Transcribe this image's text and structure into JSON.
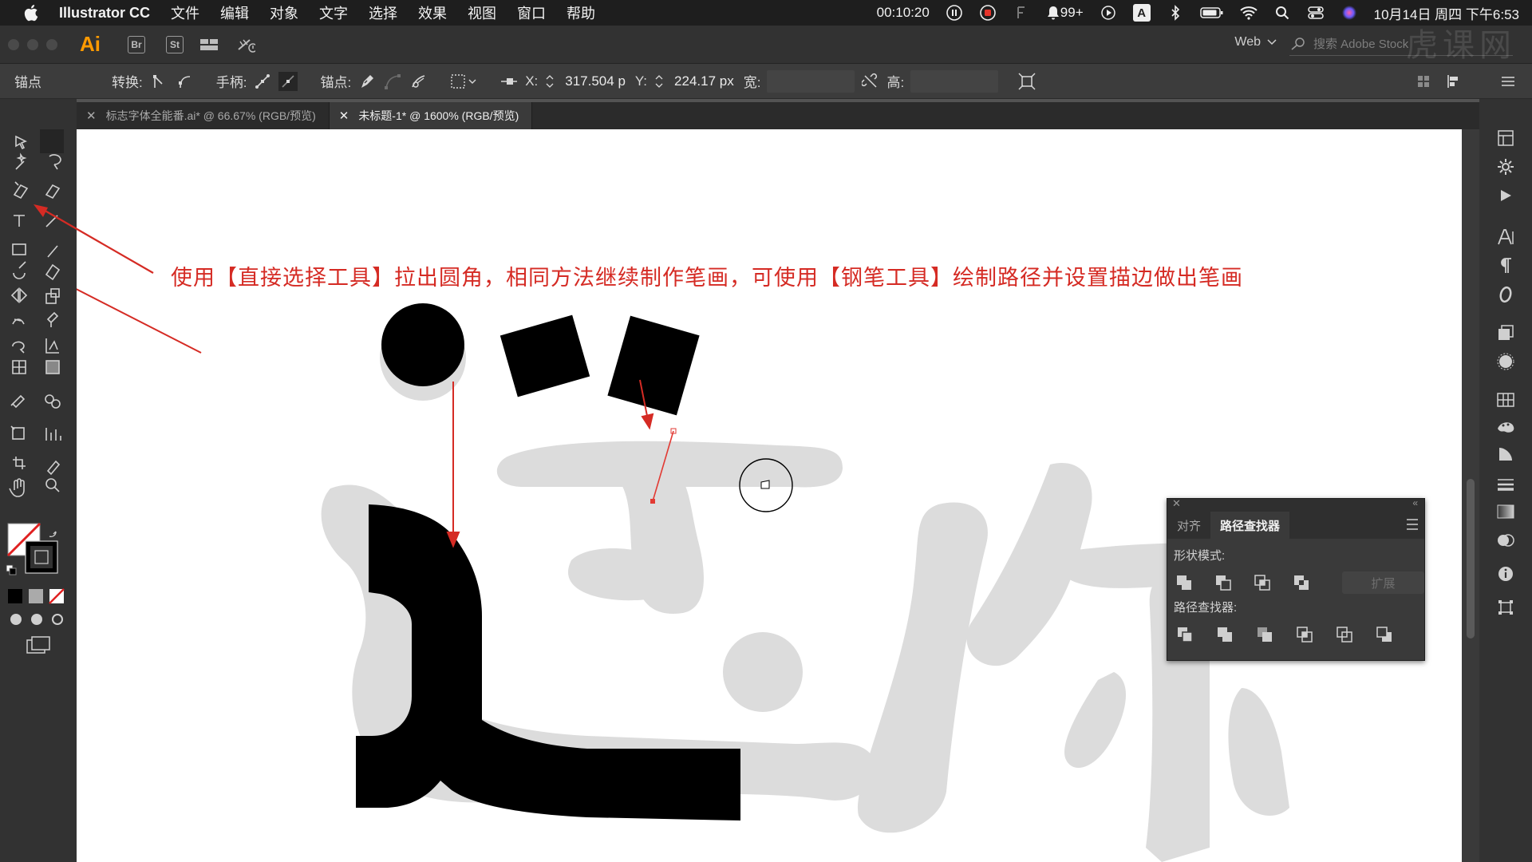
{
  "menubar": {
    "app_name": "Illustrator CC",
    "items": [
      "文件",
      "编辑",
      "对象",
      "文字",
      "选择",
      "效果",
      "视图",
      "窗口",
      "帮助"
    ],
    "timer": "00:10:20",
    "notifications": "99+",
    "input_method": "A",
    "datetime": "10月14日 周四 下午6:53"
  },
  "appbar": {
    "logo": "Ai",
    "bridge": "Br",
    "stock": "St",
    "workspace": "Web",
    "search_placeholder": "搜索 Adobe Stock"
  },
  "controlbar": {
    "label": "锚点",
    "convert": "转换:",
    "handles": "手柄:",
    "anchors": "锚点:",
    "x_label": "X:",
    "x_value": "317.504 p",
    "y_label": "Y:",
    "y_value": "224.17 px",
    "w_label": "宽:",
    "h_label": "高:"
  },
  "tabs": [
    {
      "label": "标志字体全能番.ai* @ 66.67% (RGB/预览)",
      "active": false
    },
    {
      "label": "未标题-1* @ 1600% (RGB/预览)",
      "active": true
    }
  ],
  "canvas": {
    "annotation": "使用【直接选择工具】拉出圆角，相同方法继续制作笔画，可使用【钢笔工具】绘制路径并设置描边做出笔画",
    "annotation_color": "#d52b24",
    "reference_glyphs": "送你",
    "reference_color": "#dcdcdc",
    "shape_color": "#000000"
  },
  "pathfinder": {
    "tab_align": "对齐",
    "tab_pathfinder": "路径查找器",
    "shape_modes_label": "形状模式:",
    "expand_label": "扩展",
    "pathfinders_label": "路径查找器:"
  },
  "watermark": "虎课网"
}
